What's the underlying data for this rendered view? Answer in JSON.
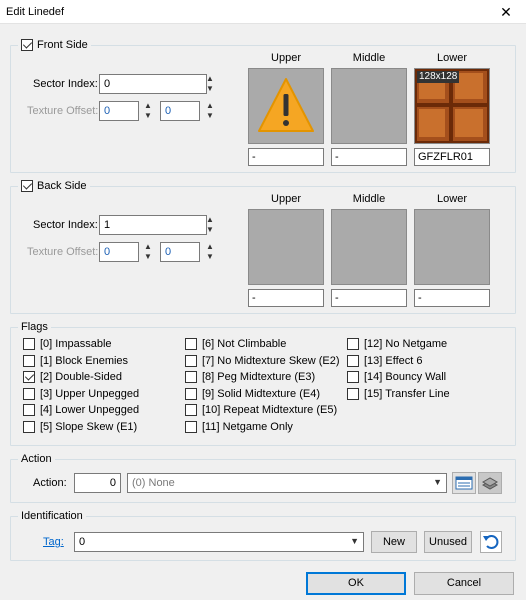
{
  "window": {
    "title": "Edit Linedef",
    "close_glyph": "✕"
  },
  "front": {
    "legend": "Front Side",
    "checked": true,
    "sector_label": "Sector Index:",
    "sector_value": "0",
    "offset_label": "Texture Offset:",
    "offset_x": "0",
    "offset_y": "0",
    "columns": [
      "Upper",
      "Middle",
      "Lower"
    ],
    "upper_name": "-",
    "middle_name": "-",
    "lower_name": "GFZFLR01",
    "lower_size": "128x128"
  },
  "back": {
    "legend": "Back Side",
    "checked": true,
    "sector_label": "Sector Index:",
    "sector_value": "1",
    "offset_label": "Texture Offset:",
    "offset_x": "0",
    "offset_y": "0",
    "columns": [
      "Upper",
      "Middle",
      "Lower"
    ],
    "upper_name": "-",
    "middle_name": "-",
    "lower_name": "-"
  },
  "flags": {
    "legend": "Flags",
    "items": [
      {
        "label": "[0] Impassable",
        "checked": false
      },
      {
        "label": "[1] Block Enemies",
        "checked": false
      },
      {
        "label": "[2] Double-Sided",
        "checked": true
      },
      {
        "label": "[3] Upper Unpegged",
        "checked": false
      },
      {
        "label": "[4] Lower Unpegged",
        "checked": false
      },
      {
        "label": "[5] Slope Skew (E1)",
        "checked": false
      },
      {
        "label": "[6] Not Climbable",
        "checked": false
      },
      {
        "label": "[7] No Midtexture Skew (E2)",
        "checked": false
      },
      {
        "label": "[8] Peg Midtexture (E3)",
        "checked": false
      },
      {
        "label": "[9] Solid Midtexture (E4)",
        "checked": false
      },
      {
        "label": "[10] Repeat Midtexture (E5)",
        "checked": false
      },
      {
        "label": "[11] Netgame Only",
        "checked": false
      },
      {
        "label": "[12] No Netgame",
        "checked": false
      },
      {
        "label": "[13] Effect 6",
        "checked": false
      },
      {
        "label": "[14] Bouncy Wall",
        "checked": false
      },
      {
        "label": "[15] Transfer Line",
        "checked": false
      }
    ]
  },
  "action": {
    "legend": "Action",
    "label": "Action:",
    "value": "0",
    "selected": "(0) None"
  },
  "identification": {
    "legend": "Identification",
    "tag_label": "Tag:",
    "tag_value": "0",
    "new_label": "New",
    "unused_label": "Unused"
  },
  "footer": {
    "ok_label": "OK",
    "cancel_label": "Cancel"
  },
  "colors": {
    "accent": "#0078d7",
    "link": "#0066cc",
    "warning": "#f5a623"
  }
}
